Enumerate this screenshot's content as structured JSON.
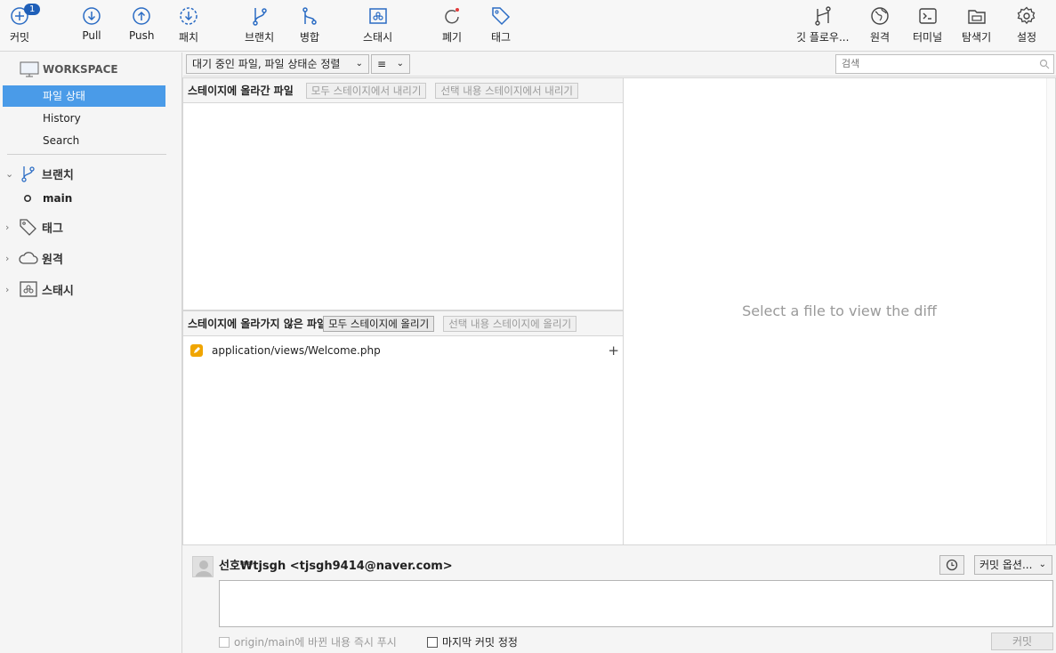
{
  "toolbar": {
    "commit_label": "커밋",
    "commit_badge": "1",
    "pull_label": "Pull",
    "push_label": "Push",
    "patch_label": "패치",
    "branch_label": "브랜치",
    "merge_label": "병합",
    "stash_label": "스태시",
    "discard_label": "폐기",
    "tag_label": "태그",
    "gitflow_label": "깃 플로우...",
    "remote_label": "원격",
    "terminal_label": "터미널",
    "explorer_label": "탐색기",
    "settings_label": "설정"
  },
  "sidebar": {
    "workspace_title": "WORKSPACE",
    "items": [
      {
        "label": "파일 상태"
      },
      {
        "label": "History"
      },
      {
        "label": "Search"
      }
    ],
    "branches_title": "브랜치",
    "current_branch": "main",
    "tags_title": "태그",
    "remotes_title": "원격",
    "stashes_title": "스태시"
  },
  "filter": {
    "sort_label": "대기 중인 파일, 파일 상태순 정렬",
    "view_label": "≡",
    "search_placeholder": "검색"
  },
  "staged": {
    "title": "스테이지에 올라간 파일",
    "unstage_all": "모두 스테이지에서 내리기",
    "unstage_selected": "선택 내용 스테이지에서 내리기"
  },
  "unstaged": {
    "title": "스테이지에 올라가지 않은 파일",
    "stage_all": "모두 스테이지에 올리기",
    "stage_selected": "선택 내용 스테이지에 올리기",
    "files": [
      {
        "path": "application/views/Welcome.php",
        "status": "modified"
      }
    ]
  },
  "diff": {
    "placeholder": "Select a file to view the diff"
  },
  "commit": {
    "author": "선호₩tjsgh <tjsgh9414@naver.com>",
    "options_label": "커밋 옵션...",
    "push_option": "origin/main에 바뀐 내용 즉시 푸시",
    "amend_option": "마지막 커밋 정정",
    "commit_button": "커밋"
  },
  "colors": {
    "accent": "#4a9be8",
    "icon_blue": "#2b6cc4",
    "badge": "#1f5fb8",
    "modified": "#f0a500"
  }
}
